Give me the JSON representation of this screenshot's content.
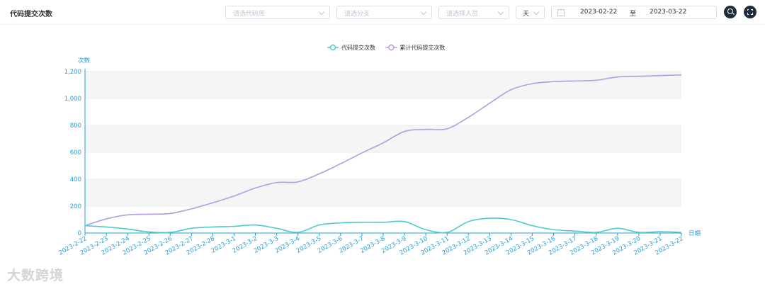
{
  "header": {
    "title": "代码提交次数"
  },
  "filters": {
    "repo_placeholder": "请选代码库",
    "branch_placeholder": "请选分支",
    "person_placeholder": "请选择人员",
    "granularity": "天",
    "start_date": "2023-02-22",
    "range_separator": "至",
    "end_date": "2023-03-22"
  },
  "watermark": "大数跨境",
  "colors": {
    "series1": "#4fcacf",
    "series2": "#b79be0",
    "axis": "#1e9fd8"
  },
  "chart_data": {
    "type": "line",
    "ylabel": "次数",
    "xlabel": "日期",
    "ylim": [
      0,
      1200
    ],
    "yticks": [
      0,
      200,
      400,
      600,
      800,
      1000,
      1200
    ],
    "ytick_labels": [
      "0",
      "200",
      "400",
      "600",
      "800",
      "1,000",
      "1,200"
    ],
    "legend_position": "top-center",
    "categories": [
      "2023-2-22",
      "2023-2-23",
      "2023-2-24",
      "2023-2-25",
      "2023-2-26",
      "2023-2-27",
      "2023-2-28",
      "2023-3-1",
      "2023-3-2",
      "2023-3-3",
      "2023-3-4",
      "2023-3-5",
      "2023-3-6",
      "2023-3-7",
      "2023-3-8",
      "2023-3-9",
      "2023-3-10",
      "2023-3-11",
      "2023-3-12",
      "2023-3-13",
      "2023-3-14",
      "2023-3-15",
      "2023-3-16",
      "2023-3-17",
      "2023-3-18",
      "2023-3-19",
      "2023-3-20",
      "2023-3-21",
      "2023-3-22"
    ],
    "series": [
      {
        "name": "代码提交次数",
        "values": [
          55,
          45,
          30,
          8,
          5,
          35,
          45,
          50,
          60,
          35,
          5,
          60,
          75,
          80,
          80,
          85,
          25,
          5,
          85,
          110,
          100,
          55,
          25,
          15,
          5,
          35,
          5,
          10,
          5
        ]
      },
      {
        "name": "累计代码提交次数",
        "values": [
          55,
          105,
          135,
          140,
          145,
          180,
          225,
          275,
          335,
          375,
          380,
          440,
          515,
          595,
          670,
          755,
          770,
          775,
          860,
          965,
          1065,
          1110,
          1125,
          1130,
          1135,
          1160,
          1165,
          1170,
          1175
        ]
      }
    ]
  }
}
